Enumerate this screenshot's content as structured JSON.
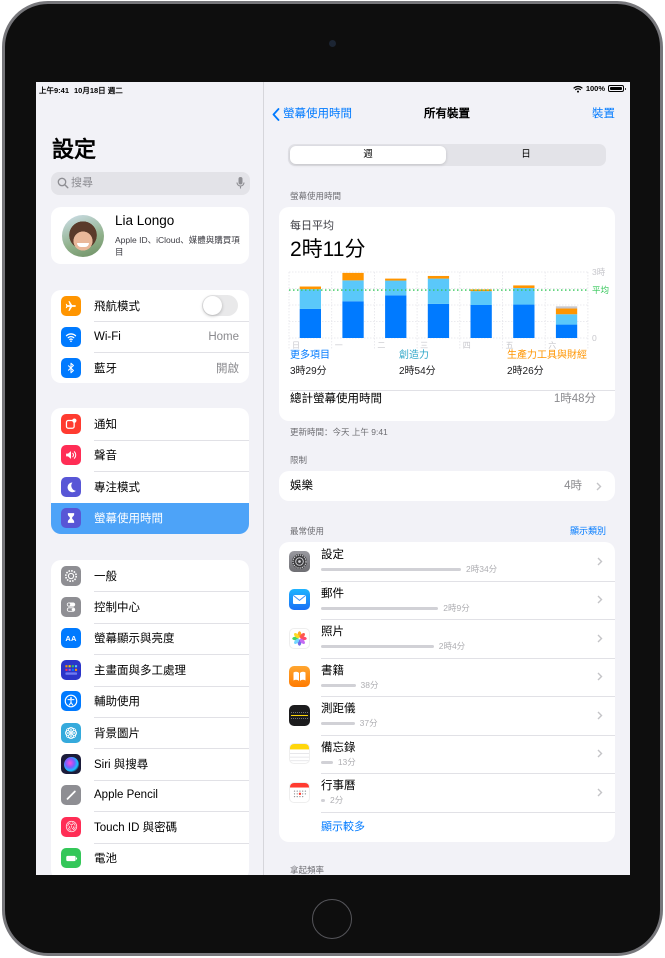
{
  "status_bar": {
    "time": "上午9:41",
    "date": "10月18日 週二",
    "battery": "100%"
  },
  "sidebar": {
    "title": "設定",
    "search_placeholder": "搜尋",
    "profile": {
      "name": "Lia Longo",
      "subtitle": "Apple ID、iCloud、媒體與購買項目"
    },
    "selected_color": "#4da3f8",
    "groups": [
      {
        "items": [
          {
            "label": "飛航模式",
            "icon": "airplane-icon",
            "color": "#ff9500",
            "toggle_on": false
          },
          {
            "label": "Wi-Fi",
            "value": "Home",
            "icon": "wifi-icon",
            "color": "#007aff"
          },
          {
            "label": "藍牙",
            "value": "開啟",
            "icon": "bluetooth-icon",
            "color": "#007aff"
          }
        ]
      },
      {
        "items": [
          {
            "label": "通知",
            "icon": "notifications-icon",
            "color": "#ff3b30"
          },
          {
            "label": "聲音",
            "icon": "sounds-icon",
            "color": "#ff2d55"
          },
          {
            "label": "專注模式",
            "icon": "moon-icon",
            "color": "#5856d6"
          },
          {
            "label": "螢幕使用時間",
            "icon": "hourglass-icon",
            "color": "#5856d6",
            "selected": true
          }
        ]
      },
      {
        "items": [
          {
            "label": "一般",
            "icon": "gear-icon",
            "color": "#8e8e93"
          },
          {
            "label": "控制中心",
            "icon": "control-center-icon",
            "color": "#8e8e93"
          },
          {
            "label": "螢幕顯示與亮度",
            "icon": "display-brightness-icon",
            "color": "#007aff"
          },
          {
            "label": "主畫面與多工處理",
            "icon": "home-screen-icon",
            "color": "#2b35c9"
          },
          {
            "label": "輔助使用",
            "icon": "accessibility-icon",
            "color": "#007aff"
          },
          {
            "label": "背景圖片",
            "icon": "wallpaper-icon",
            "color": "#35aadc"
          },
          {
            "label": "Siri 與搜尋",
            "icon": "siri-icon",
            "color": "#1c1c3a"
          },
          {
            "label": "Apple Pencil",
            "icon": "pencil-icon",
            "color": "#8e8e93"
          },
          {
            "label": "Touch ID 與密碼",
            "icon": "fingerprint-icon",
            "color": "#ff2d55"
          },
          {
            "label": "電池",
            "icon": "battery-icon",
            "color": "#34c759"
          }
        ]
      }
    ]
  },
  "detail": {
    "back_label": "螢幕使用時間",
    "title": "所有裝置",
    "right_button": "裝置",
    "segments": [
      {
        "label": "週",
        "selected": true
      },
      {
        "label": "日",
        "selected": false
      }
    ],
    "screen_time_header": "螢幕使用時間",
    "daily_average_label": "每日平均",
    "daily_average_value": "2時11分",
    "legend": [
      {
        "label": "更多項目",
        "value": "3時29分",
        "color": "#007aff"
      },
      {
        "label": "創造力",
        "value": "2時54分",
        "color": "#30a7c9"
      },
      {
        "label": "生產力工具與財經",
        "value": "2時26分",
        "color": "#ff9500"
      }
    ],
    "total_label": "總計螢幕使用時間",
    "total_value": "1時48分",
    "updated": "更新時間：今天 上午 9:41",
    "limits_header": "限制",
    "limits": [
      {
        "label": "娛樂",
        "value": "4時"
      }
    ],
    "most_used_header": "最常使用",
    "show_categories": "顯示類別",
    "apps": [
      {
        "name": "設定",
        "time": "2時34分",
        "minutes": 154,
        "icon": "settings-app-icon"
      },
      {
        "name": "郵件",
        "time": "2時9分",
        "minutes": 129,
        "icon": "mail-app-icon"
      },
      {
        "name": "照片",
        "time": "2時4分",
        "minutes": 124,
        "icon": "photos-app-icon"
      },
      {
        "name": "書籍",
        "time": "38分",
        "minutes": 38,
        "icon": "books-app-icon"
      },
      {
        "name": "測距儀",
        "time": "37分",
        "minutes": 37,
        "icon": "measure-app-icon"
      },
      {
        "name": "備忘錄",
        "time": "13分",
        "minutes": 13,
        "icon": "notes-app-icon"
      },
      {
        "name": "行事曆",
        "time": "2分",
        "minutes": 2,
        "icon": "calendar-app-icon"
      }
    ],
    "show_more": "顯示較多",
    "pickups_header": "拿起頻率"
  },
  "chart_data": {
    "type": "bar",
    "stacked": true,
    "title": "每日平均",
    "categories": [
      "日",
      "一",
      "二",
      "三",
      "四",
      "五",
      "六"
    ],
    "unit": "hours",
    "series": [
      {
        "name": "更多項目",
        "color": "#007aff",
        "values": [
          1.32,
          1.67,
          1.94,
          1.55,
          1.5,
          1.52,
          0.61
        ]
      },
      {
        "name": "創造力",
        "color": "#5ac8fa",
        "values": [
          0.9,
          0.95,
          0.67,
          1.15,
          0.63,
          0.75,
          0.47
        ]
      },
      {
        "name": "生產力工具與財經",
        "color": "#ff9500",
        "values": [
          0.12,
          0.34,
          0.09,
          0.12,
          0.08,
          0.12,
          0.26
        ]
      },
      {
        "name": "",
        "color": "#c7c7cc",
        "values": [
          0,
          0,
          0,
          0,
          0,
          0,
          0.1
        ]
      }
    ],
    "average": 2.18,
    "average_label": "平均",
    "average_color": "#34c759",
    "y_max_label": "3時",
    "y_zero_label": "0",
    "ylim": [
      0,
      3
    ],
    "grid": true,
    "axis_side": "right"
  }
}
